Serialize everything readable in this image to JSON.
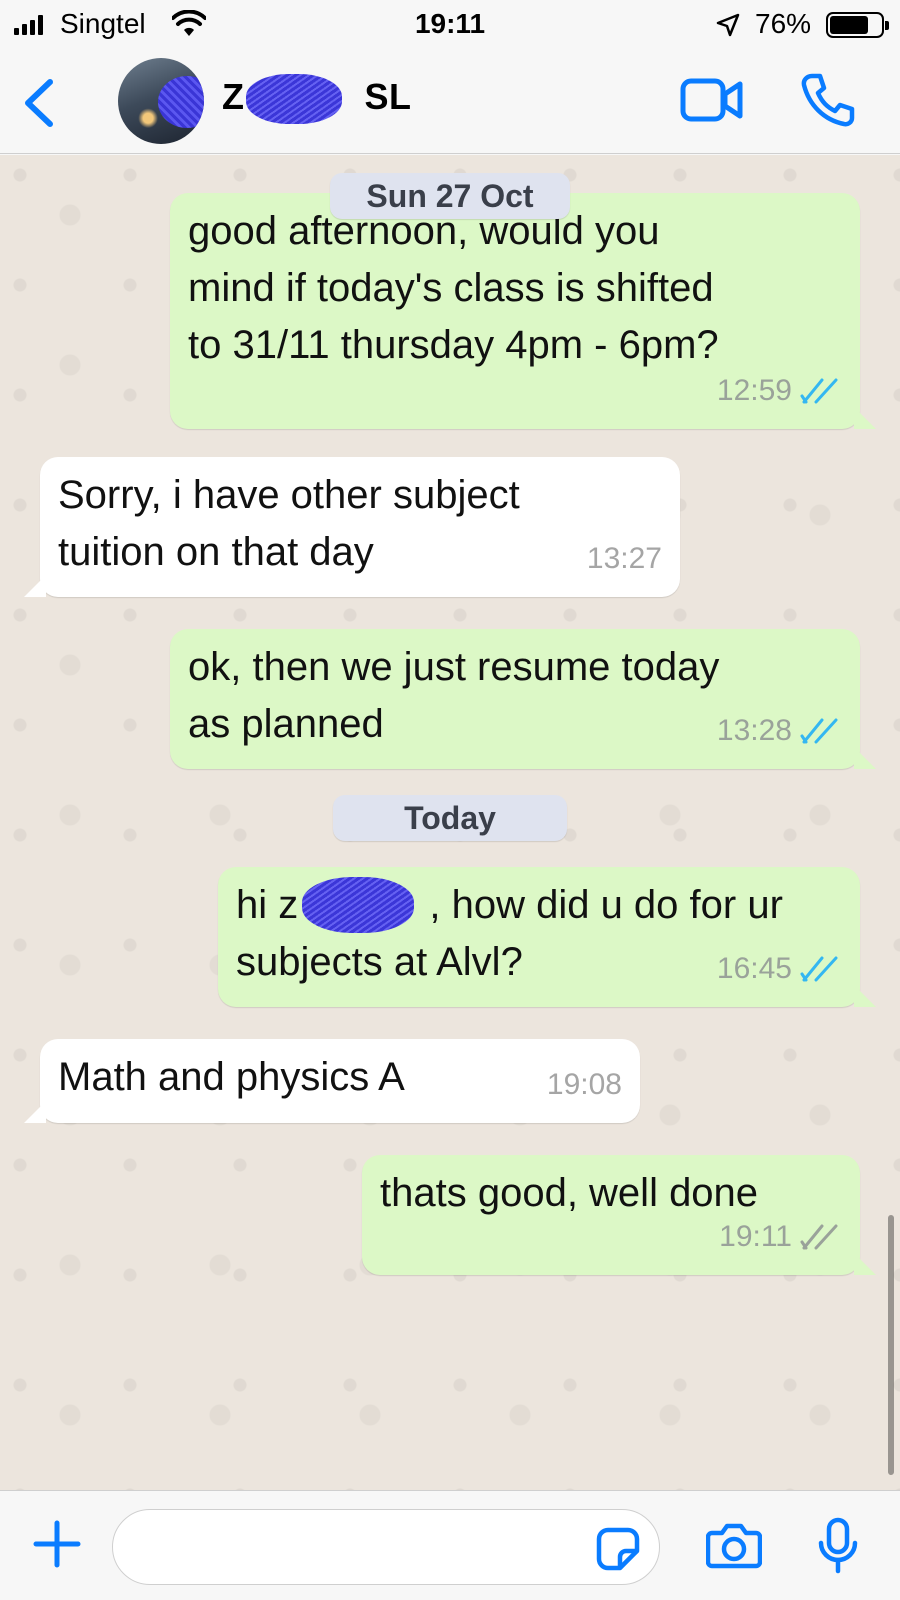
{
  "status_bar": {
    "carrier": "Singtel",
    "time": "19:11",
    "battery_percent": "76%",
    "battery_level": 0.76
  },
  "header": {
    "contact_name": "Z    SL",
    "icons": {
      "back": "chevron-left-icon",
      "video": "video-camera-icon",
      "call": "phone-icon"
    }
  },
  "messages": [
    {
      "type": "date",
      "label": "Sun 27 Oct"
    },
    {
      "type": "outgoing",
      "text": "good afternoon, would you\nmind if today's class is shifted\nto 31/11 thursday 4pm - 6pm?",
      "time": "12:59",
      "status": "read"
    },
    {
      "type": "incoming",
      "text": "Sorry, i have other subject\ntuition on that day",
      "time": "13:27"
    },
    {
      "type": "outgoing",
      "text": "ok, then we just resume today\nas planned",
      "time": "13:28",
      "status": "read"
    },
    {
      "type": "date",
      "label": "Today"
    },
    {
      "type": "outgoing",
      "text": "hi z    , how did u do for ur\nsubjects at Alvl?",
      "time": "16:45",
      "status": "read"
    },
    {
      "type": "incoming",
      "text": "Math and physics A",
      "time": "19:08"
    },
    {
      "type": "outgoing",
      "text": "thats good, well done",
      "time": "19:11",
      "status": "delivered"
    }
  ],
  "input_bar": {
    "placeholder": "",
    "icons": {
      "attach": "plus-icon",
      "sticker": "sticker-icon",
      "camera": "camera-icon",
      "mic": "microphone-icon"
    }
  },
  "colors": {
    "accent": "#0a7cff",
    "outgoing_bubble": "#dcf8c6",
    "incoming_bubble": "#ffffff",
    "chat_background": "#ece5dd",
    "read_ticks": "#34b7f1",
    "delivered_ticks": "#9aa29a"
  }
}
